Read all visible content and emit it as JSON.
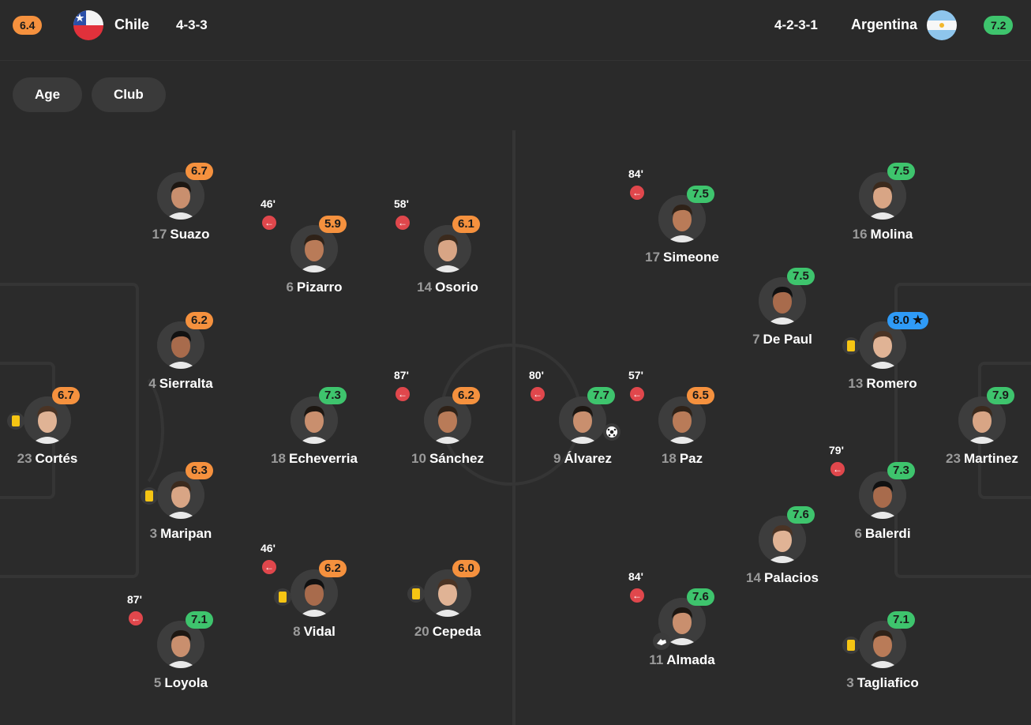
{
  "header": {
    "home": {
      "rating": "6.4",
      "name": "Chile",
      "formation": "4-3-3",
      "flag": "chile-flag"
    },
    "away": {
      "rating": "7.2",
      "name": "Argentina",
      "formation": "4-2-3-1",
      "flag": "argentina-flag"
    }
  },
  "filters": [
    "Age",
    "Club"
  ],
  "colors": {
    "orange": "#f5913e",
    "green": "#3ec46d",
    "blue": "#2f9bf7",
    "background": "#2b2b2b"
  },
  "players": [
    {
      "num": "17",
      "name": "Suazo",
      "rating": "6.7",
      "rc": "orange"
    },
    {
      "num": "6",
      "name": "Pizarro",
      "rating": "5.9",
      "rc": "orange",
      "sub": "46'"
    },
    {
      "num": "14",
      "name": "Osorio",
      "rating": "6.1",
      "rc": "orange",
      "sub": "58'"
    },
    {
      "num": "4",
      "name": "Sierralta",
      "rating": "6.2",
      "rc": "orange"
    },
    {
      "num": "23",
      "name": "Cortés",
      "rating": "6.7",
      "rc": "orange",
      "card": true
    },
    {
      "num": "18",
      "name": "Echeverria",
      "rating": "7.3",
      "rc": "green"
    },
    {
      "num": "10",
      "name": "Sánchez",
      "rating": "6.2",
      "rc": "orange",
      "sub": "87'"
    },
    {
      "num": "3",
      "name": "Maripan",
      "rating": "6.3",
      "rc": "orange",
      "card": true
    },
    {
      "num": "8",
      "name": "Vidal",
      "rating": "6.2",
      "rc": "orange",
      "sub": "46'",
      "card": true
    },
    {
      "num": "20",
      "name": "Cepeda",
      "rating": "6.0",
      "rc": "orange",
      "card": true
    },
    {
      "num": "5",
      "name": "Loyola",
      "rating": "7.1",
      "rc": "green",
      "sub": "87'"
    },
    {
      "num": "17",
      "name": "Simeone",
      "rating": "7.5",
      "rc": "green",
      "sub": "84'"
    },
    {
      "num": "16",
      "name": "Molina",
      "rating": "7.5",
      "rc": "green"
    },
    {
      "num": "7",
      "name": "De Paul",
      "rating": "7.5",
      "rc": "green"
    },
    {
      "num": "13",
      "name": "Romero",
      "rating": "8.0",
      "rc": "blue",
      "star": true,
      "card": true
    },
    {
      "num": "9",
      "name": "Álvarez",
      "rating": "7.7",
      "rc": "green",
      "sub": "80'",
      "goal": true
    },
    {
      "num": "18",
      "name": "Paz",
      "rating": "6.5",
      "rc": "orange",
      "sub": "57'"
    },
    {
      "num": "23",
      "name": "Martinez",
      "rating": "7.9",
      "rc": "green"
    },
    {
      "num": "6",
      "name": "Balerdi",
      "rating": "7.3",
      "rc": "green",
      "sub": "79'"
    },
    {
      "num": "14",
      "name": "Palacios",
      "rating": "7.6",
      "rc": "green"
    },
    {
      "num": "11",
      "name": "Almada",
      "rating": "7.6",
      "rc": "green",
      "sub": "84'",
      "assist": true
    },
    {
      "num": "3",
      "name": "Tagliafico",
      "rating": "7.1",
      "rc": "green",
      "card": true
    }
  ]
}
